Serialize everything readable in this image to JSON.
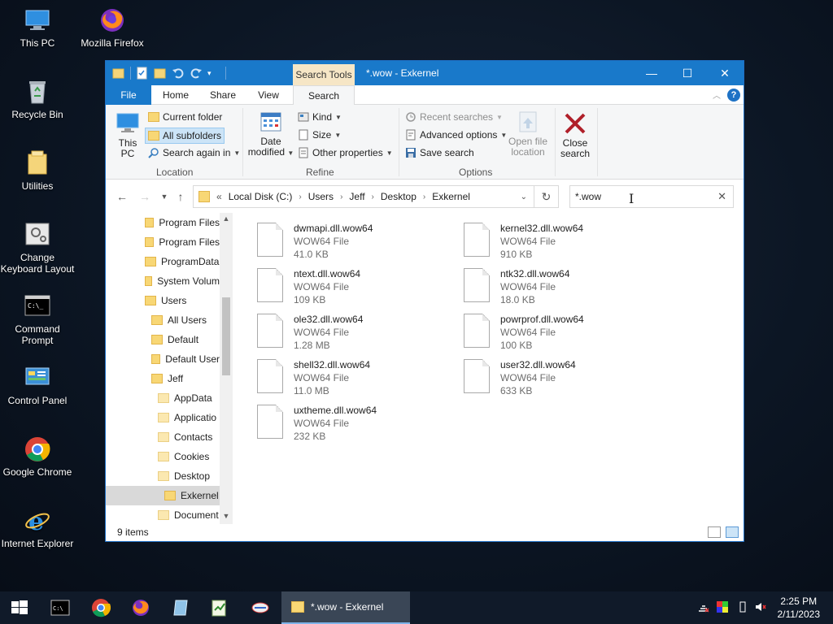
{
  "desktop": {
    "icons": [
      {
        "label": "This PC"
      },
      {
        "label": "Mozilla Firefox"
      },
      {
        "label": "Recycle Bin"
      },
      {
        "label": "Utilities"
      },
      {
        "label": "Change Keyboard Layout"
      },
      {
        "label": "Command Prompt"
      },
      {
        "label": "Control Panel"
      },
      {
        "label": "Google Chrome"
      },
      {
        "label": "Internet Explorer"
      }
    ]
  },
  "window": {
    "title": "*.wow - Exkernel",
    "context_tab": "Search Tools",
    "controls": {
      "minimize": "—",
      "maximize": "☐",
      "close": "✕"
    }
  },
  "ribbon_tabs": [
    "File",
    "Home",
    "Share",
    "View",
    "Search"
  ],
  "ribbon_active_tab": "Search",
  "ribbon": {
    "location": {
      "label": "Location",
      "this_pc": "This PC",
      "current_folder": "Current folder",
      "all_subfolders": "All subfolders",
      "search_again_in": "Search again in"
    },
    "refine": {
      "label": "Refine",
      "date_modified_1": "Date",
      "date_modified_2": "modified",
      "kind": "Kind",
      "size": "Size",
      "other_properties": "Other properties"
    },
    "options": {
      "label": "Options",
      "recent_searches": "Recent searches",
      "advanced_options": "Advanced options",
      "save_search": "Save search",
      "open_file_location_1": "Open file",
      "open_file_location_2": "location"
    },
    "close_search_1": "Close",
    "close_search_2": "search"
  },
  "address": {
    "overflow": "«",
    "crumbs": [
      "Local Disk (C:)",
      "Users",
      "Jeff",
      "Desktop",
      "Exkernel"
    ]
  },
  "search": {
    "value": "*.wow"
  },
  "nav_tree": [
    {
      "label": "Program Files",
      "indent": 0
    },
    {
      "label": "Program Files",
      "indent": 0
    },
    {
      "label": "ProgramData",
      "indent": 0
    },
    {
      "label": "System Volum",
      "indent": 0
    },
    {
      "label": "Users",
      "indent": 0
    },
    {
      "label": "All Users",
      "indent": 1
    },
    {
      "label": "Default",
      "indent": 1
    },
    {
      "label": "Default User",
      "indent": 1
    },
    {
      "label": "Jeff",
      "indent": 1
    },
    {
      "label": "AppData",
      "indent": 2
    },
    {
      "label": "Applicatio",
      "indent": 2
    },
    {
      "label": "Contacts",
      "indent": 2
    },
    {
      "label": "Cookies",
      "indent": 2
    },
    {
      "label": "Desktop",
      "indent": 2
    },
    {
      "label": "Exkernel",
      "indent": 3
    },
    {
      "label": "Document",
      "indent": 2
    }
  ],
  "nav_selected": "Exkernel",
  "files": [
    {
      "name": "dwmapi.dll.wow64",
      "type": "WOW64 File",
      "size": "41.0 KB"
    },
    {
      "name": "kernel32.dll.wow64",
      "type": "WOW64 File",
      "size": "910 KB"
    },
    {
      "name": "ntext.dll.wow64",
      "type": "WOW64 File",
      "size": "109 KB"
    },
    {
      "name": "ntk32.dll.wow64",
      "type": "WOW64 File",
      "size": "18.0 KB"
    },
    {
      "name": "ole32.dll.wow64",
      "type": "WOW64 File",
      "size": "1.28 MB"
    },
    {
      "name": "powrprof.dll.wow64",
      "type": "WOW64 File",
      "size": "100 KB"
    },
    {
      "name": "shell32.dll.wow64",
      "type": "WOW64 File",
      "size": "11.0 MB"
    },
    {
      "name": "user32.dll.wow64",
      "type": "WOW64 File",
      "size": "633 KB"
    },
    {
      "name": "uxtheme.dll.wow64",
      "type": "WOW64 File",
      "size": "232 KB"
    }
  ],
  "status": {
    "count": "9 items"
  },
  "taskbar": {
    "active_task": "*.wow - Exkernel",
    "time": "2:25 PM",
    "date": "2/11/2023"
  },
  "colors": {
    "accent": "#1979ca",
    "search_tools": "#f6e6c6",
    "close_red": "#b0202a"
  }
}
